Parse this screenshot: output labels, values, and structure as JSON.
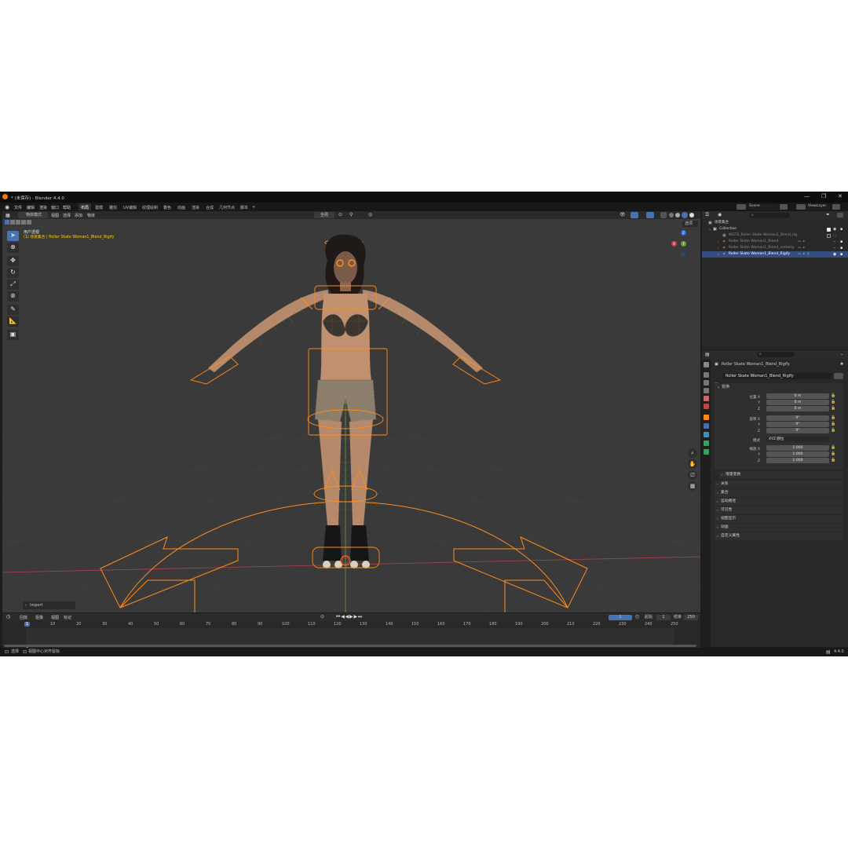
{
  "window": {
    "title": "* (未保存) - Blender 4.4.0",
    "controls": [
      "—",
      "❐",
      "✕"
    ]
  },
  "menubar": {
    "items": [
      "文件",
      "编辑",
      "渲染",
      "窗口",
      "帮助"
    ],
    "workspaces": [
      "布局",
      "建模",
      "雕刻",
      "UV编辑",
      "纹理绘制",
      "着色",
      "动画",
      "渲染",
      "合成",
      "几何节点",
      "脚本"
    ],
    "add_tab": "+",
    "scene": "Scene",
    "view_layer": "ViewLayer"
  },
  "viewport": {
    "mode": "物体模式",
    "menus": [
      "视图",
      "选择",
      "添加",
      "物体"
    ],
    "transform_orientation": "全局",
    "options": "选项",
    "view_name": "用户透视",
    "context_line": "(1) 场景集合 | Roller Skate Woman1_Blend_Rigify",
    "last_op": "Import",
    "gizmo": {
      "x": "X",
      "y": "Y",
      "z": "Z"
    }
  },
  "timeline": {
    "menus": [
      "回放",
      "抠像",
      "视图",
      "标记"
    ],
    "current_frame": "1",
    "start_label": "起始",
    "start": "1",
    "end_label": "结束",
    "end": "250",
    "ticks": [
      "1",
      "10",
      "20",
      "30",
      "40",
      "50",
      "60",
      "70",
      "80",
      "90",
      "100",
      "110",
      "120",
      "130",
      "140",
      "150",
      "160",
      "170",
      "180",
      "190",
      "200",
      "210",
      "220",
      "230",
      "240",
      "250"
    ]
  },
  "statusbar": {
    "left": "选择",
    "hint": "视图中心对齐鼠标",
    "version": "4.4.0"
  },
  "outliner": {
    "search_placeholder": "",
    "rows": [
      {
        "label": "场景集合"
      },
      {
        "label": "Collection"
      },
      {
        "label": "WGTS_Roller Skate Woman1_Blend_rig"
      },
      {
        "label": "Roller Skate Woman1_Blend"
      },
      {
        "label": "Roller Skate Woman1_Blend_metarig"
      },
      {
        "label": "Roller Skate Woman1_Blend_Rigify"
      }
    ]
  },
  "properties": {
    "search_placeholder": "",
    "object_name": "Roller Skate Woman1_Blend_Rigify",
    "data_name": "Roller Skate Woman1_Blend_Rigify",
    "transform_title": "变换",
    "location_label": "位置 X",
    "rotation_label": "旋转 X",
    "mode_label": "模式",
    "mode_value": "XYZ 欧拉",
    "scale_label": "缩放 X",
    "y_label": "Y",
    "z_label": "Z",
    "location": [
      "0 m",
      "0 m",
      "0 m"
    ],
    "rotation": [
      "0°",
      "0°",
      "0°"
    ],
    "scale": [
      "1.000",
      "1.000",
      "1.000"
    ],
    "delta_transform": "增量变换",
    "panels": [
      "关系",
      "集合",
      "运动路径",
      "可见性",
      "视图显示",
      "动画",
      "自定义属性"
    ]
  },
  "colors": {
    "accent": "#4772b3",
    "selection": "#ff8c1a",
    "info_text": "#ffd000"
  }
}
